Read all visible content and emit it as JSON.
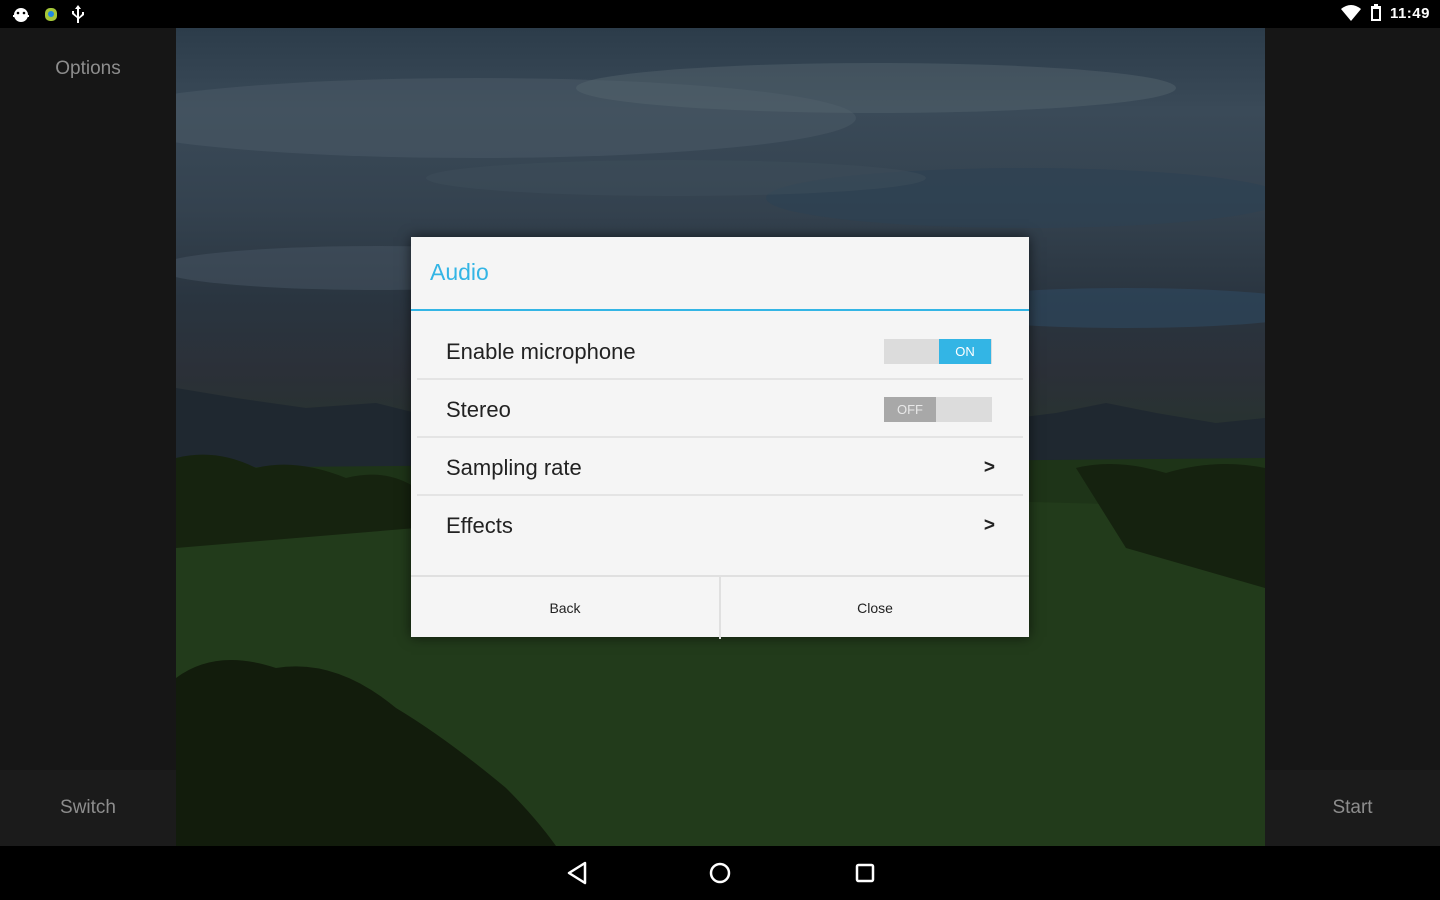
{
  "status_bar": {
    "time": "11:49",
    "left_icons": [
      "android-debug-icon",
      "android-robot-icon",
      "usb-icon"
    ],
    "right_icons": [
      "wifi-icon",
      "battery-icon"
    ]
  },
  "left_panel": {
    "top_label": "Options",
    "bottom_label": "Switch"
  },
  "right_panel": {
    "bottom_label": "Start"
  },
  "dialog": {
    "title": "Audio",
    "accent_color": "#33b5e5",
    "rows": [
      {
        "label": "Enable microphone",
        "control": "toggle",
        "state": "ON"
      },
      {
        "label": "Stereo",
        "control": "toggle",
        "state": "OFF"
      },
      {
        "label": "Sampling rate",
        "control": "chevron",
        "symbol": ">"
      },
      {
        "label": "Effects",
        "control": "chevron",
        "symbol": ">"
      }
    ],
    "buttons": {
      "back": "Back",
      "close": "Close"
    }
  },
  "nav_bar": {
    "icons": [
      "back-triangle-icon",
      "home-circle-icon",
      "recents-square-icon"
    ]
  }
}
